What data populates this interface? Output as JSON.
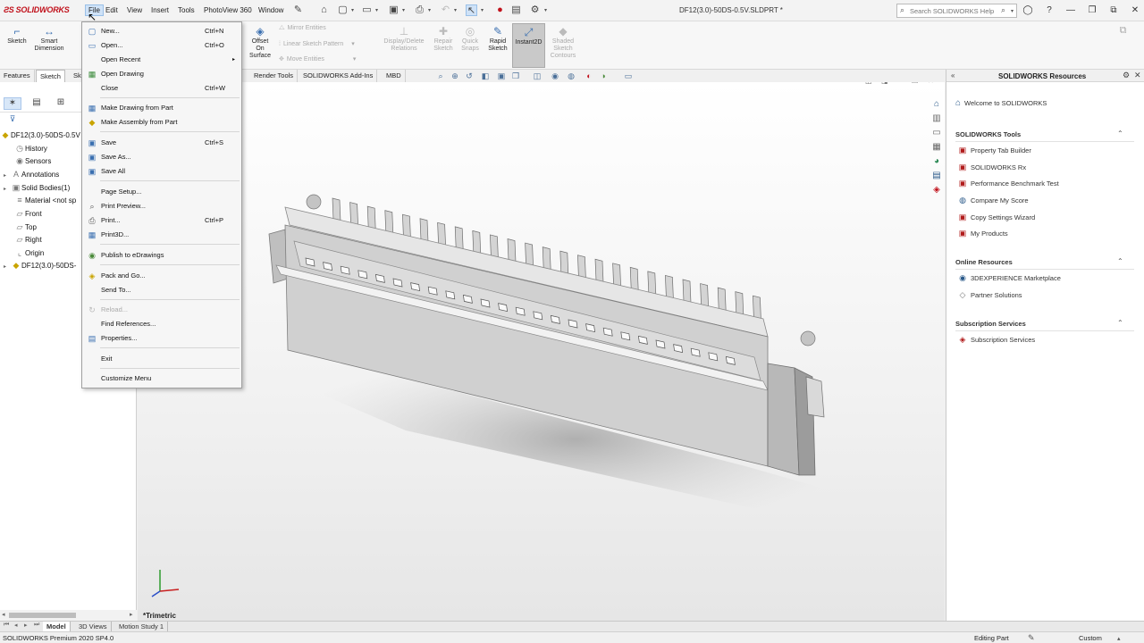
{
  "app": {
    "logo_text": "SOLIDWORKS",
    "doc_title": "DF12(3.0)-50DS-0.5V.SLDPRT *",
    "help_search_placeholder": "Search SOLIDWORKS Help"
  },
  "menubar": {
    "items": [
      "File",
      "Edit",
      "View",
      "Insert",
      "Tools",
      "PhotoView 360",
      "Window"
    ]
  },
  "command_manager": {
    "sketch": "Sketch",
    "smart_dimension_1": "Smart",
    "smart_dimension_2": "Dimension",
    "offset_on_surface_1": "Offset",
    "offset_on_surface_2": "On",
    "offset_on_surface_3": "Surface",
    "mirror_entities": "Mirror Entities",
    "linear_sketch_pattern": "Linear Sketch Pattern",
    "move_entities": "Move Entities",
    "display_delete_relations_1": "Display/Delete",
    "display_delete_relations_2": "Relations",
    "repair_sketch_1": "Repair",
    "repair_sketch_2": "Sketch",
    "quick_snaps_1": "Quick",
    "quick_snaps_2": "Snaps",
    "rapid_sketch_1": "Rapid",
    "rapid_sketch_2": "Sketch",
    "instant2d": "Instant2D",
    "shaded_sketch_contours_1": "Shaded",
    "shaded_sketch_contours_2": "Sketch",
    "shaded_sketch_contours_3": "Contours"
  },
  "tabs": {
    "features": "Features",
    "sketch": "Sketch",
    "sketch_partial": "Sk",
    "render_tools": "Render Tools",
    "addins": "SOLIDWORKS Add-Ins",
    "mbd": "MBD"
  },
  "feature_tree": {
    "root": "DF12(3.0)-50DS-0.5V",
    "items": [
      "History",
      "Sensors",
      "Annotations",
      "Solid Bodies(1)",
      "Material <not sp",
      "Front",
      "Top",
      "Right",
      "Origin",
      "DF12(3.0)-50DS-"
    ]
  },
  "file_menu": {
    "new": "New...",
    "new_sc": "Ctrl+N",
    "open": "Open...",
    "open_sc": "Ctrl+O",
    "open_recent": "Open Recent",
    "open_drawing": "Open Drawing",
    "close": "Close",
    "close_sc": "Ctrl+W",
    "make_drawing": "Make Drawing from Part",
    "make_assembly": "Make Assembly from Part",
    "save": "Save",
    "save_sc": "Ctrl+S",
    "save_as": "Save As...",
    "save_all": "Save All",
    "page_setup": "Page Setup...",
    "print_preview": "Print Preview...",
    "print": "Print...",
    "print_sc": "Ctrl+P",
    "print3d": "Print3D...",
    "publish_edrawings": "Publish to eDrawings",
    "pack_and_go": "Pack and Go...",
    "send_to": "Send To...",
    "reload": "Reload...",
    "find_references": "Find References...",
    "properties": "Properties...",
    "exit": "Exit",
    "customize_menu": "Customize Menu"
  },
  "viewport": {
    "view_label": "*Trimetric",
    "colors": {
      "body": "#d2d2d2",
      "body_dark": "#8e8e8e",
      "body_light": "#ececec"
    }
  },
  "bottom_tabs": [
    "Model",
    "3D Views",
    "Motion Study 1"
  ],
  "statusbar": {
    "product": "SOLIDWORKS Premium 2020 SP4.0",
    "editing": "Editing Part",
    "units": "Custom"
  },
  "task_pane": {
    "title": "SOLIDWORKS Resources",
    "welcome": "Welcome to SOLIDWORKS",
    "tools_header": "SOLIDWORKS Tools",
    "tools": [
      "Property Tab Builder",
      "SOLIDWORKS Rx",
      "Performance Benchmark Test",
      "Compare My Score",
      "Copy Settings Wizard",
      "My Products"
    ],
    "online_header": "Online Resources",
    "online": [
      "3DEXPERIENCE Marketplace",
      "Partner Solutions"
    ],
    "subscription_header": "Subscription Services",
    "subscription": [
      "Subscription Services"
    ]
  }
}
